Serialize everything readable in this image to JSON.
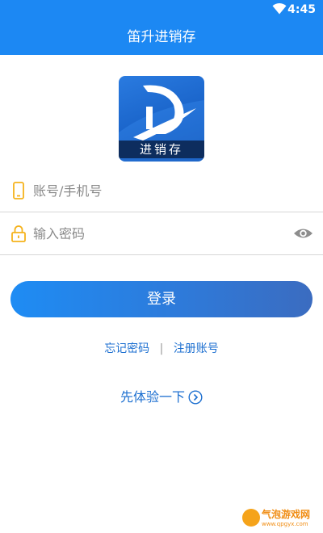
{
  "status_bar": {
    "time": "4:45",
    "icons": [
      "wifi-icon"
    ]
  },
  "header": {
    "title": "笛升进销存"
  },
  "logo": {
    "text": "进销存",
    "icon": "app-logo-icon"
  },
  "form": {
    "account": {
      "placeholder": "账号/手机号",
      "value": "",
      "icon": "phone-icon"
    },
    "password": {
      "placeholder": "输入密码",
      "value": "",
      "icon": "lock-icon",
      "toggle_icon": "eye-icon"
    },
    "login_label": "登录"
  },
  "links": {
    "forgot_password": "忘记密码",
    "divider": "|",
    "register": "注册账号"
  },
  "trial": {
    "label": "先体验一下",
    "icon": "chevron-right-circle-icon"
  },
  "watermark": {
    "title": "气泡游戏网",
    "url": "www.qpgyx.com"
  },
  "colors": {
    "primary": "#1c88f3",
    "link": "#1c6fd0",
    "icon_yellow": "#f5b21b",
    "divider": "#d6d6d6"
  }
}
